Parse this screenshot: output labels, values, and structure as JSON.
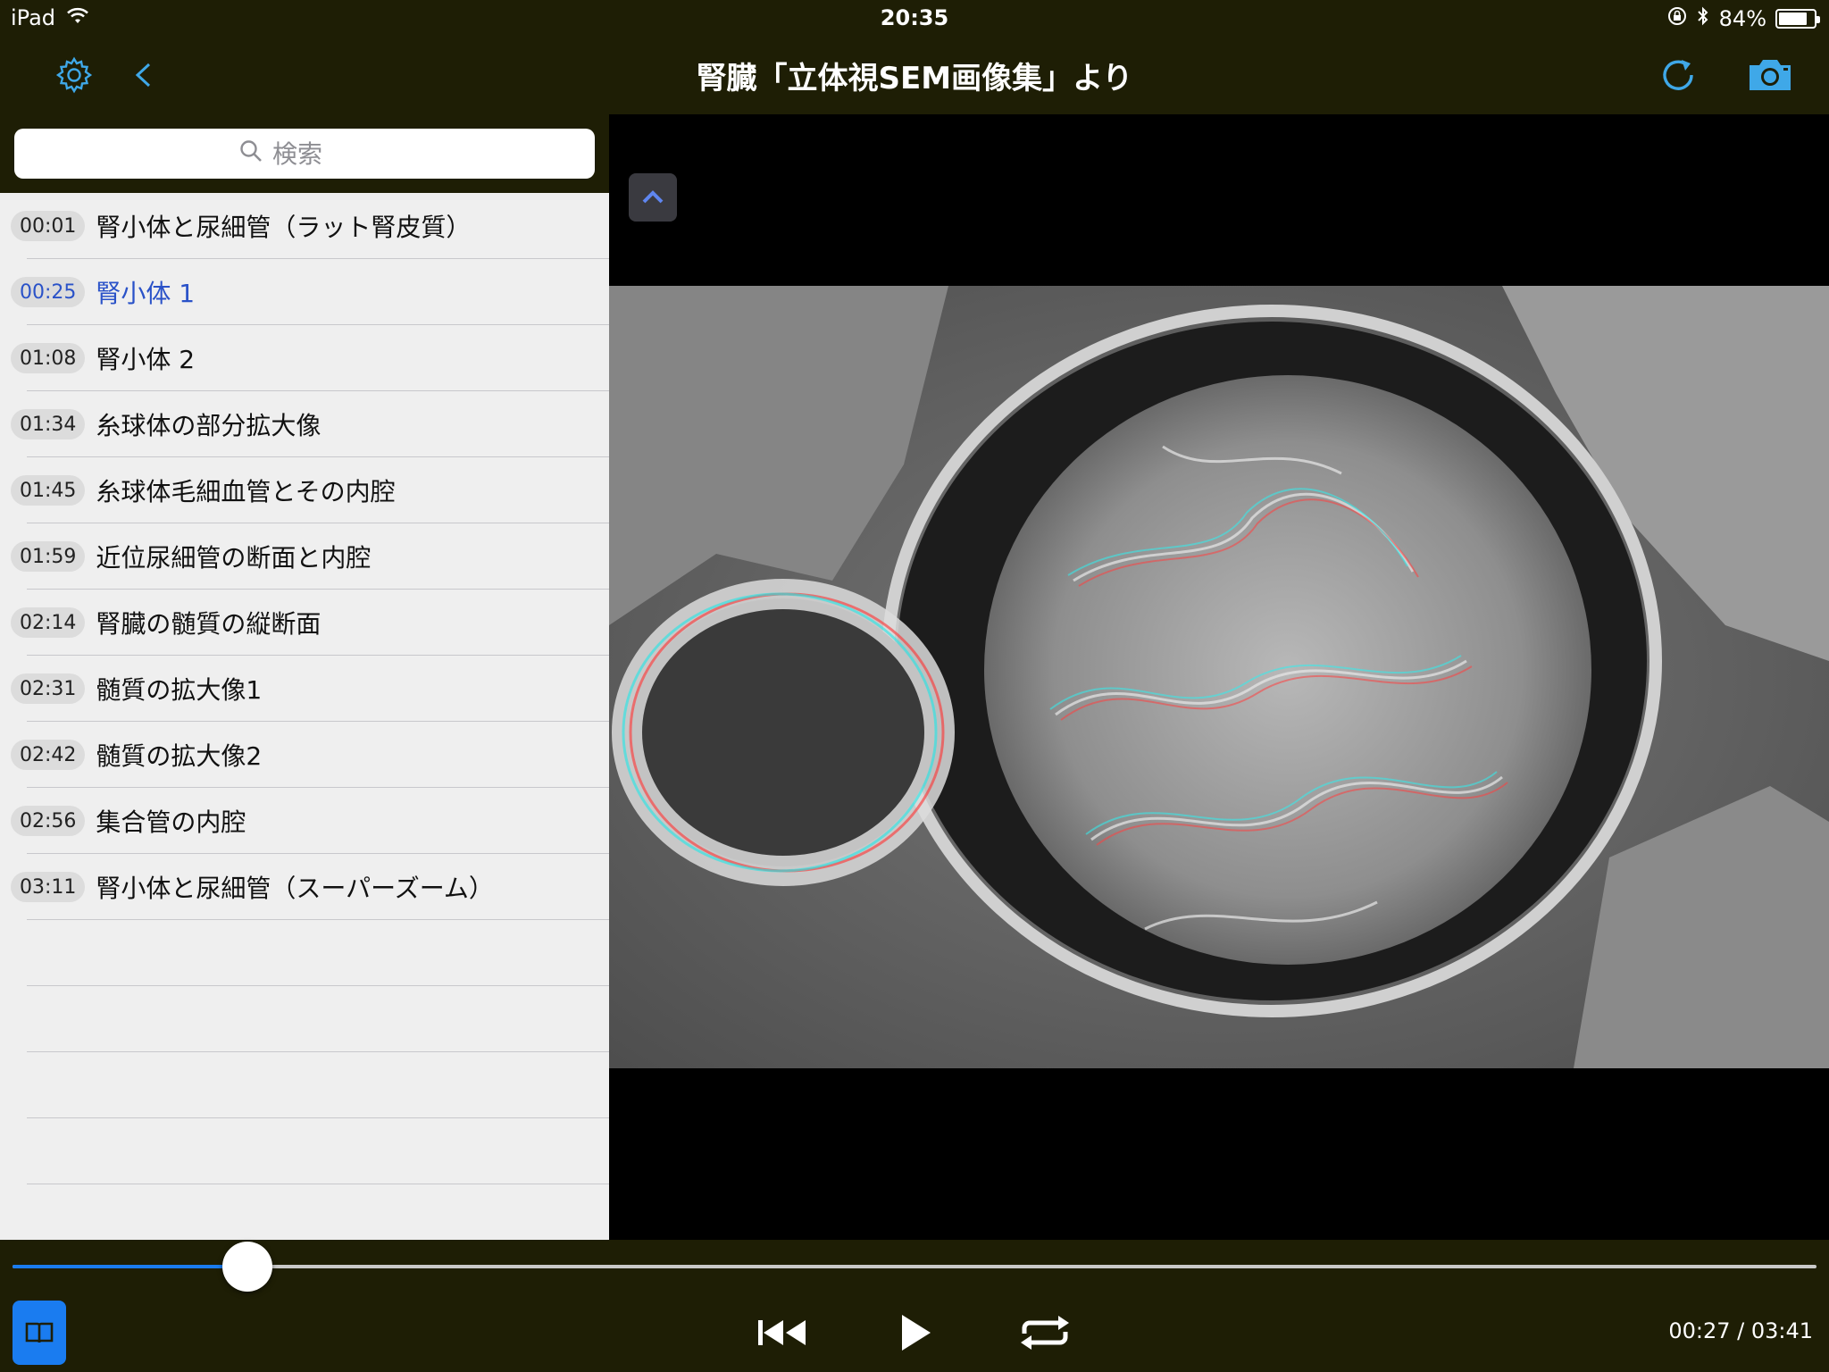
{
  "status": {
    "device": "iPad",
    "time": "20:35",
    "battery_text": "84%",
    "battery_level": 0.84
  },
  "nav": {
    "title": "腎臓「立体視SEM画像集」より"
  },
  "search": {
    "placeholder": "検索"
  },
  "chapters": [
    {
      "time": "00:01",
      "label": "腎小体と尿細管（ラット腎皮質）",
      "active": false
    },
    {
      "time": "00:25",
      "label": "腎小体 1",
      "active": true
    },
    {
      "time": "01:08",
      "label": "腎小体 2",
      "active": false
    },
    {
      "time": "01:34",
      "label": "糸球体の部分拡大像",
      "active": false
    },
    {
      "time": "01:45",
      "label": "糸球体毛細血管とその内腔",
      "active": false
    },
    {
      "time": "01:59",
      "label": "近位尿細管の断面と内腔",
      "active": false
    },
    {
      "time": "02:14",
      "label": "腎臓の髄質の縦断面",
      "active": false
    },
    {
      "time": "02:31",
      "label": "髄質の拡大像1",
      "active": false
    },
    {
      "time": "02:42",
      "label": "髄質の拡大像2",
      "active": false
    },
    {
      "time": "02:56",
      "label": "集合管の内腔",
      "active": false
    },
    {
      "time": "03:11",
      "label": "腎小体と尿細管（スーパーズーム）",
      "active": false
    }
  ],
  "player": {
    "current": "00:27",
    "total": "03:41",
    "timecode": "00:27 / 03:41",
    "progress": 0.13
  },
  "colors": {
    "bar": "#1e1e05",
    "accent": "#1a7cf0",
    "icon": "#3fa8e8",
    "active_text": "#2a52c8"
  }
}
